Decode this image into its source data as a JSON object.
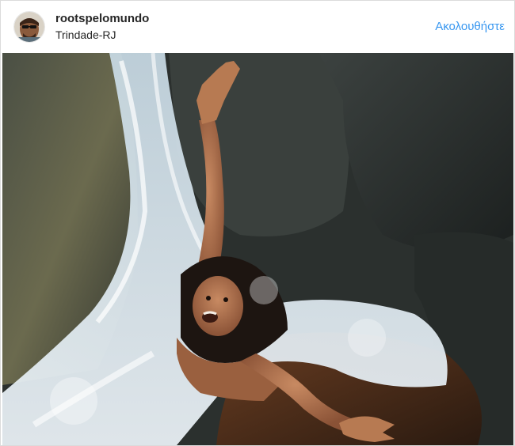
{
  "post": {
    "username": "rootspelomundo",
    "location": "Trindade-RJ",
    "follow_label": "Ακολουθήστε"
  },
  "icons": {
    "avatar": "profile-avatar-photo"
  },
  "colors": {
    "accent": "#3897f0",
    "text": "#262626",
    "border": "#dbdbdb"
  }
}
